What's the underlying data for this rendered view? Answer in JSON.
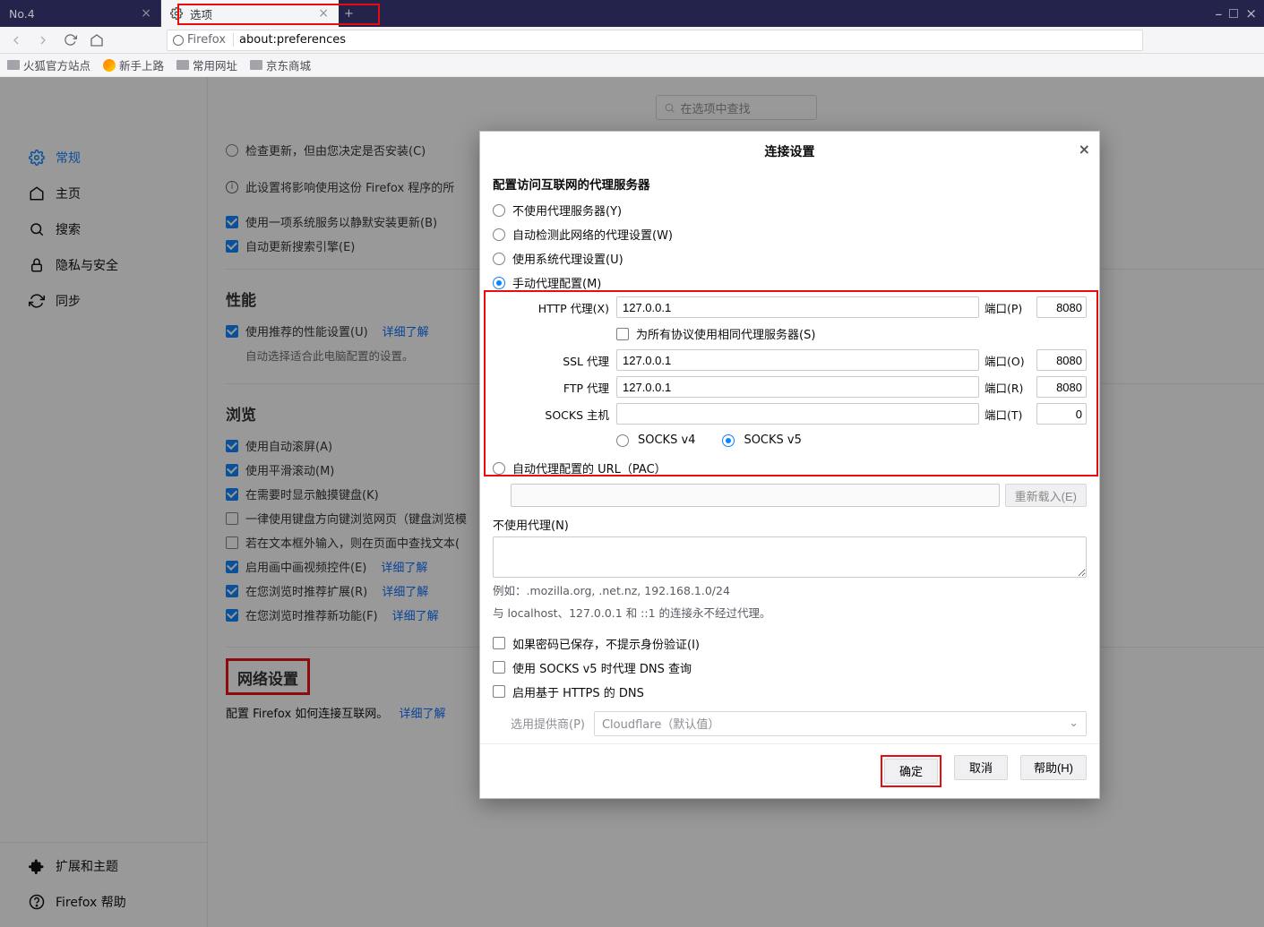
{
  "tabs": [
    {
      "title": "No.4"
    },
    {
      "title": "选项",
      "active": true
    }
  ],
  "url": {
    "product": "Firefox",
    "path": "about:preferences"
  },
  "bookmarks": [
    "火狐官方站点",
    "新手上路",
    "常用网址",
    "京东商城"
  ],
  "sidebar": {
    "items": [
      {
        "label": "常规",
        "icon": "gear",
        "selected": true
      },
      {
        "label": "主页",
        "icon": "home"
      },
      {
        "label": "搜索",
        "icon": "search"
      },
      {
        "label": "隐私与安全",
        "icon": "lock"
      },
      {
        "label": "同步",
        "icon": "sync"
      }
    ],
    "ext_label": "扩展和主题",
    "help_label": "Firefox 帮助"
  },
  "search_placeholder": "在选项中查找",
  "updates": {
    "radio_check_label": "检查更新，但由您决定是否安装(C)",
    "info_note": "此设置将影响使用这份 Firefox 程序的所",
    "chk_silent": "使用一项系统服务以静默安装更新(B)",
    "chk_eng": "自动更新搜索引擎(E)"
  },
  "perf": {
    "title": "性能",
    "chk_rec": "使用推荐的性能设置(U)",
    "detail": "详细了解",
    "note": "自动选择适合此电脑配置的设置。"
  },
  "browse": {
    "title": "浏览",
    "chk_auto_scroll": "使用自动滚屏(A)",
    "chk_smooth": "使用平滑滚动(M)",
    "chk_touch_kb": "在需要时显示触摸键盘(K)",
    "chk_arrow_nav": "一律使用键盘方向键浏览网页（键盘浏览模",
    "chk_text_search": "若在文本框外输入，则在页面中查找文本(",
    "chk_pip": "启用画中画视频控件(E)",
    "chk_rec_ext": "在您浏览时推荐扩展(R)",
    "chk_rec_feat": "在您浏览时推荐新功能(F)"
  },
  "network": {
    "title": "网络设置",
    "desc": "配置 Firefox 如何连接互联网。",
    "detail": "详细了解"
  },
  "modal": {
    "title": "连接设置",
    "h3": "配置访问互联网的代理服务器",
    "opt_none": "不使用代理服务器(Y)",
    "opt_auto_detect": "自动检测此网络的代理设置(W)",
    "opt_system": "使用系统代理设置(U)",
    "opt_manual": "手动代理配置(M)",
    "lab_http": "HTTP 代理(X)",
    "lab_ssl": "SSL 代理",
    "lab_ftp": "FTP 代理",
    "lab_socks": "SOCKS 主机",
    "lab_port_p": "端口(P)",
    "lab_port_o": "端口(O)",
    "lab_port_r": "端口(R)",
    "lab_port_t": "端口(T)",
    "http_host": "127.0.0.1",
    "http_port": "8080",
    "ssl_host": "127.0.0.1",
    "ssl_port": "8080",
    "ftp_host": "127.0.0.1",
    "ftp_port": "8080",
    "socks_host": "",
    "socks_port": "0",
    "chk_same": "为所有协议使用相同代理服务器(S)",
    "socks_v4": "SOCKS v4",
    "socks_v5": "SOCKS v5",
    "opt_pac": "自动代理配置的 URL（PAC）",
    "reload": "重新载入(E)",
    "noproxy_h": "不使用代理(N)",
    "noproxy_eg": "例如：.mozilla.org, .net.nz, 192.168.1.0/24",
    "noproxy_note": "与 localhost、127.0.0.1 和 ::1 的连接永不经过代理。",
    "chk_noauth": "如果密码已保存，不提示身份验证(I)",
    "chk_socks_dns": "使用 SOCKS v5 时代理 DNS 查询",
    "chk_https_dns": "启用基于 HTTPS 的 DNS",
    "provider_lab": "选用提供商(P)",
    "provider_val": "Cloudflare（默认值）",
    "ok": "确定",
    "cancel": "取消",
    "help": "帮助(H)"
  }
}
